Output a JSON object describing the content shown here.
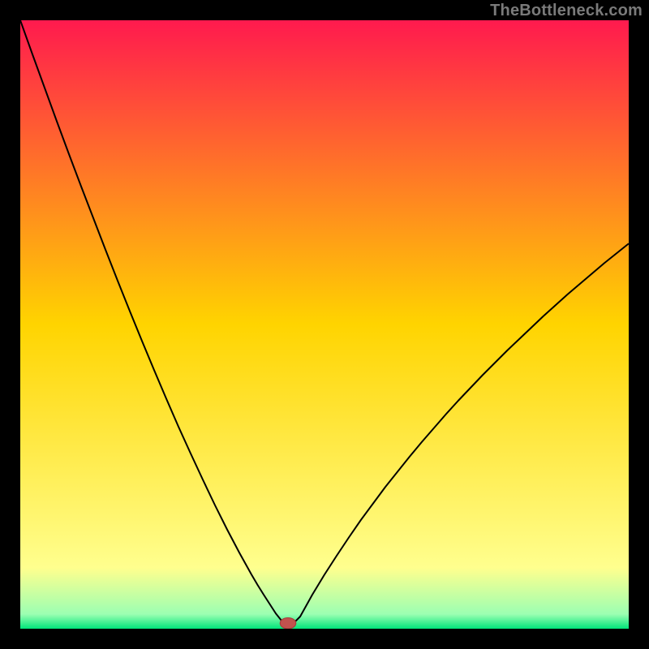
{
  "watermark": "TheBottleneck.com",
  "colors": {
    "frame_bg": "#000000",
    "grad_top": "#ff1a4e",
    "grad_mid": "#ffd400",
    "grad_low": "#ffff8e",
    "grad_bottom": "#00e57a",
    "curve": "#000000",
    "marker_fill": "#c1524e",
    "marker_stroke": "#a83b3b"
  },
  "chart_data": {
    "type": "line",
    "title": "",
    "xlabel": "",
    "ylabel": "",
    "xlim": [
      0,
      100
    ],
    "ylim": [
      0,
      100
    ],
    "x": [
      0,
      2,
      4,
      6,
      8,
      10,
      12,
      14,
      16,
      18,
      20,
      22,
      24,
      26,
      28,
      30,
      32,
      34,
      36,
      38,
      39,
      40,
      42,
      44,
      46,
      48,
      50,
      52,
      54,
      56,
      58,
      60,
      62,
      64,
      66,
      68,
      70,
      72,
      74,
      76,
      78,
      80,
      82,
      84,
      86,
      88,
      90,
      92,
      94,
      96,
      98,
      100
    ],
    "values": [
      100,
      94.4,
      88.9,
      83.4,
      78.0,
      72.7,
      67.5,
      62.3,
      57.2,
      52.2,
      47.3,
      42.5,
      37.8,
      33.2,
      28.8,
      24.5,
      20.3,
      16.3,
      12.5,
      8.9,
      7.2,
      5.6,
      2.5,
      0,
      2.0,
      5.6,
      8.9,
      12.0,
      15.0,
      17.9,
      20.6,
      23.3,
      25.8,
      28.3,
      30.7,
      33.0,
      35.3,
      37.5,
      39.6,
      41.7,
      43.7,
      45.7,
      47.6,
      49.5,
      51.4,
      53.2,
      55.0,
      56.7,
      58.4,
      60.1,
      61.7,
      63.3
    ],
    "marker": {
      "x": 44,
      "y": 0
    },
    "gradient_bands": [
      {
        "y": 2.4,
        "color": "grad_bottom"
      },
      {
        "y": 6.0,
        "color": "grad_low"
      },
      {
        "y": 60.0,
        "color": "grad_mid"
      },
      {
        "y": 100.0,
        "color": "grad_top"
      }
    ]
  }
}
